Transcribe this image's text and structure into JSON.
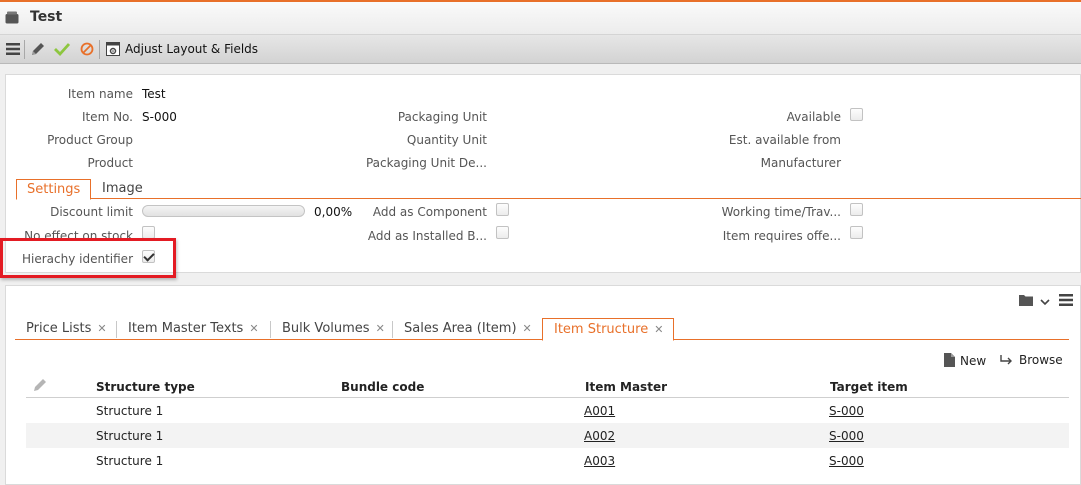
{
  "window": {
    "title": "Test"
  },
  "toolbar": {
    "items": [
      {
        "icon": "menu-icon"
      },
      {
        "icon": "edit-icon"
      },
      {
        "icon": "checkmark-icon",
        "color": "#8dc63f"
      },
      {
        "icon": "cancel-icon",
        "color": "#e8702a"
      },
      {
        "icon": "layout-settings-icon"
      }
    ],
    "adjust_label": "Adjust Layout & Fields"
  },
  "form": {
    "fields": {
      "item_name": {
        "label": "Item name",
        "value": "Test"
      },
      "item_no": {
        "label": "Item No.",
        "value": "S-000"
      },
      "product_group": {
        "label": "Product Group",
        "value": ""
      },
      "product": {
        "label": "Product",
        "value": ""
      },
      "packaging_unit": {
        "label": "Packaging Unit",
        "value": ""
      },
      "quantity_unit": {
        "label": "Quantity Unit",
        "value": ""
      },
      "packaging_unit_de": {
        "label": "Packaging Unit De...",
        "value": ""
      },
      "available": {
        "label": "Available",
        "checked": false
      },
      "est_available_from": {
        "label": "Est. available from",
        "value": ""
      },
      "manufacturer": {
        "label": "Manufacturer",
        "value": ""
      }
    },
    "tabs": [
      "Settings",
      "Image"
    ],
    "active_tab": "Settings",
    "settings": {
      "discount_limit": {
        "label": "Discount limit",
        "value": "0,00%",
        "fraction": 0.0
      },
      "no_effect_on_stock": {
        "label": "No effect on stock",
        "checked": false
      },
      "hierachy_identifier": {
        "label": "Hierachy identifier",
        "checked": true
      },
      "add_as_component": {
        "label": "Add as Component",
        "checked": false
      },
      "add_as_installed": {
        "label": "Add as Installed B...",
        "checked": false
      },
      "working_time": {
        "label": "Working time/Trav...",
        "checked": false
      },
      "item_requires_offer": {
        "label": "Item requires offe...",
        "checked": false
      }
    }
  },
  "bottom": {
    "tabs": [
      {
        "label": "Price Lists",
        "close": "✕"
      },
      {
        "label": "Item Master Texts",
        "close": "✕"
      },
      {
        "label": "Bulk Volumes",
        "close": "✕"
      },
      {
        "label": "Sales Area (Item)",
        "close": "✕"
      },
      {
        "label": "Item Structure",
        "close": "✕"
      }
    ],
    "active_tab": "Item Structure",
    "actions": {
      "new_label": "New",
      "browse_label": "Browse"
    },
    "table": {
      "columns": [
        "Structure type",
        "Bundle code",
        "Item Master",
        "Target item"
      ],
      "rows": [
        [
          "Structure 1",
          "",
          "A001",
          "S-000"
        ],
        [
          "Structure 1",
          "",
          "A002",
          "S-000"
        ],
        [
          "Structure 1",
          "",
          "A003",
          "S-000"
        ]
      ]
    }
  },
  "colors": {
    "accent": "#e8702a",
    "highlight": "#e31b23"
  }
}
